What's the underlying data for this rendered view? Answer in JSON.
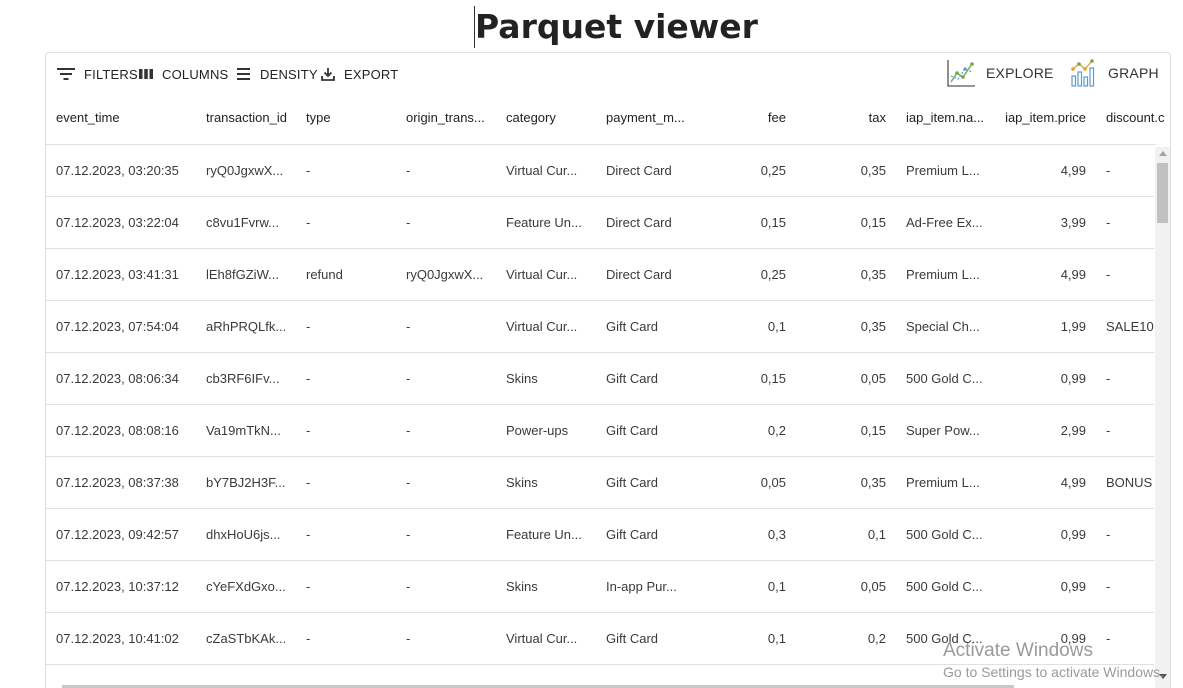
{
  "title": "Parquet viewer",
  "toolbar": {
    "filters_label": "FILTERS",
    "columns_label": "COLUMNS",
    "density_label": "DENSITY",
    "export_label": "EXPORT",
    "explore_label": "EXPLORE",
    "graph_label": "GRAPH"
  },
  "table": {
    "columns": [
      "event_time",
      "transaction_id",
      "type",
      "origin_trans...",
      "category",
      "payment_m...",
      "fee",
      "tax",
      "iap_item.na...",
      "iap_item.price",
      "discount.c"
    ],
    "rows": [
      [
        "07.12.2023, 03:20:35",
        "ryQ0JgxwX...",
        "-",
        "-",
        "Virtual Cur...",
        "Direct Card",
        "0,25",
        "0,35",
        "Premium L...",
        "4,99",
        "-"
      ],
      [
        "07.12.2023, 03:22:04",
        "c8vu1Fvrw...",
        "-",
        "-",
        "Feature Un...",
        "Direct Card",
        "0,15",
        "0,15",
        "Ad-Free Ex...",
        "3,99",
        "-"
      ],
      [
        "07.12.2023, 03:41:31",
        "lEh8fGZiW...",
        "refund",
        "ryQ0JgxwX...",
        "Virtual Cur...",
        "Direct Card",
        "0,25",
        "0,35",
        "Premium L...",
        "4,99",
        "-"
      ],
      [
        "07.12.2023, 07:54:04",
        "aRhPRQLfk...",
        "-",
        "-",
        "Virtual Cur...",
        "Gift Card",
        "0,1",
        "0,35",
        "Special Ch...",
        "1,99",
        "SALE10"
      ],
      [
        "07.12.2023, 08:06:34",
        "cb3RF6IFv...",
        "-",
        "-",
        "Skins",
        "Gift Card",
        "0,15",
        "0,05",
        "500 Gold C...",
        "0,99",
        "-"
      ],
      [
        "07.12.2023, 08:08:16",
        "Va19mTkN...",
        "-",
        "-",
        "Power-ups",
        "Gift Card",
        "0,2",
        "0,15",
        "Super Pow...",
        "2,99",
        "-"
      ],
      [
        "07.12.2023, 08:37:38",
        "bY7BJ2H3F...",
        "-",
        "-",
        "Skins",
        "Gift Card",
        "0,05",
        "0,35",
        "Premium L...",
        "4,99",
        "BONUS"
      ],
      [
        "07.12.2023, 09:42:57",
        "dhxHoU6js...",
        "-",
        "-",
        "Feature Un...",
        "Gift Card",
        "0,3",
        "0,1",
        "500 Gold C...",
        "0,99",
        "-"
      ],
      [
        "07.12.2023, 10:37:12",
        "cYeFXdGxo...",
        "-",
        "-",
        "Skins",
        "In-app Pur...",
        "0,1",
        "0,05",
        "500 Gold C...",
        "0,99",
        "-"
      ],
      [
        "07.12.2023, 10:41:02",
        "cZaSTbKAk...",
        "-",
        "-",
        "Virtual Cur...",
        "Gift Card",
        "0,1",
        "0,2",
        "500 Gold C...",
        "0,99",
        "-"
      ]
    ]
  },
  "watermark": {
    "line1": "Activate Windows",
    "line2": "Go to Settings to activate Windows."
  },
  "icons": {
    "filters": "filter-lines-icon",
    "columns": "columns-icon",
    "density": "density-icon",
    "export": "export-download-icon",
    "explore": "line-chart-icon",
    "graph": "bar-line-chart-icon"
  }
}
